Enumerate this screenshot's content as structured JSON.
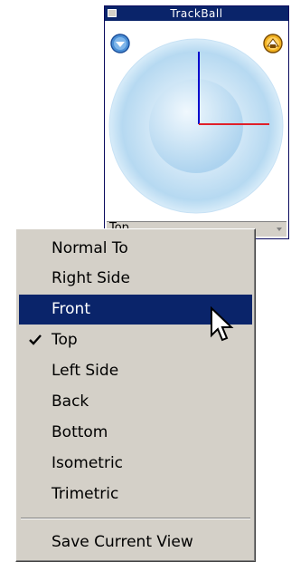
{
  "trackball": {
    "title": "TrackBall",
    "left_button_icon": "rotate-down-icon",
    "right_button_icon": "home-view-icon",
    "view_combo_value": "Top",
    "axis_colors": {
      "vertical": "#0000cc",
      "horizontal": "#e0202a"
    }
  },
  "menu": {
    "items": [
      {
        "label": "Normal To",
        "checked": false,
        "selected": false
      },
      {
        "label": "Right Side",
        "checked": false,
        "selected": false
      },
      {
        "label": "Front",
        "checked": false,
        "selected": true
      },
      {
        "label": "Top",
        "checked": true,
        "selected": false
      },
      {
        "label": "Left Side",
        "checked": false,
        "selected": false
      },
      {
        "label": "Back",
        "checked": false,
        "selected": false
      },
      {
        "label": "Bottom",
        "checked": false,
        "selected": false
      },
      {
        "label": "Isometric",
        "checked": false,
        "selected": false
      },
      {
        "label": "Trimetric",
        "checked": false,
        "selected": false
      }
    ],
    "footer_item": {
      "label": "Save Current View"
    },
    "highlight_color": "#0a246a",
    "background_color": "#d4d0c8"
  }
}
